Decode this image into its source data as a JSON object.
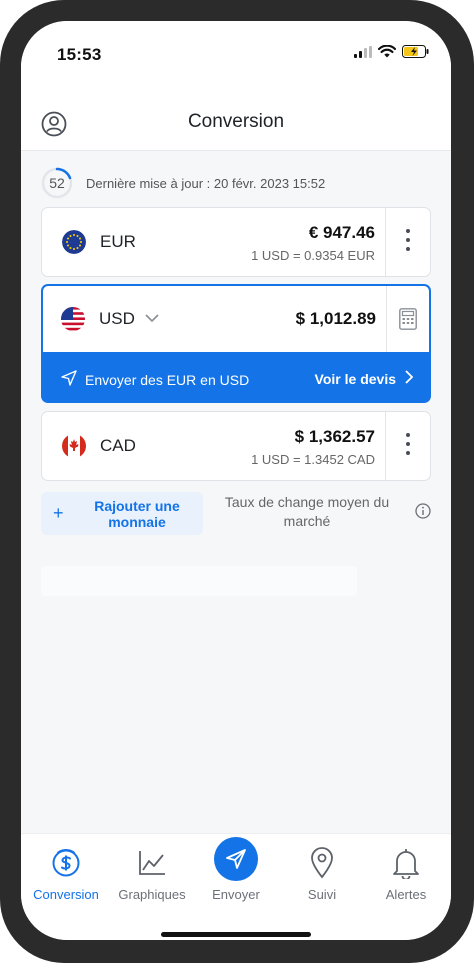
{
  "status_bar": {
    "time": "15:53"
  },
  "header": {
    "title": "Conversion"
  },
  "update": {
    "countdown": "52",
    "text": "Dernière mise à jour : 20 févr. 2023 15:52"
  },
  "currencies": {
    "eur": {
      "code": "EUR",
      "amount": "€ 947.46",
      "rate": "1 USD = 0.9354 EUR"
    },
    "usd": {
      "code": "USD",
      "amount": "$ 1,012.89",
      "send_label": "Envoyer des EUR en USD",
      "quote_label": "Voir le devis"
    },
    "cad": {
      "code": "CAD",
      "amount": "$ 1,362.57",
      "rate": "1 USD = 1.3452 CAD"
    }
  },
  "add_currency": {
    "label": "Rajouter une monnaie",
    "plus": "+"
  },
  "mid_market": {
    "label": "Taux de change moyen du marché"
  },
  "tabs": [
    {
      "label": "Conversion"
    },
    {
      "label": "Graphiques"
    },
    {
      "label": "Envoyer"
    },
    {
      "label": "Suivi"
    },
    {
      "label": "Alertes"
    }
  ],
  "colors": {
    "accent": "#1473e6",
    "frame": "#2b2b2b",
    "background": "#f6f7f8"
  }
}
